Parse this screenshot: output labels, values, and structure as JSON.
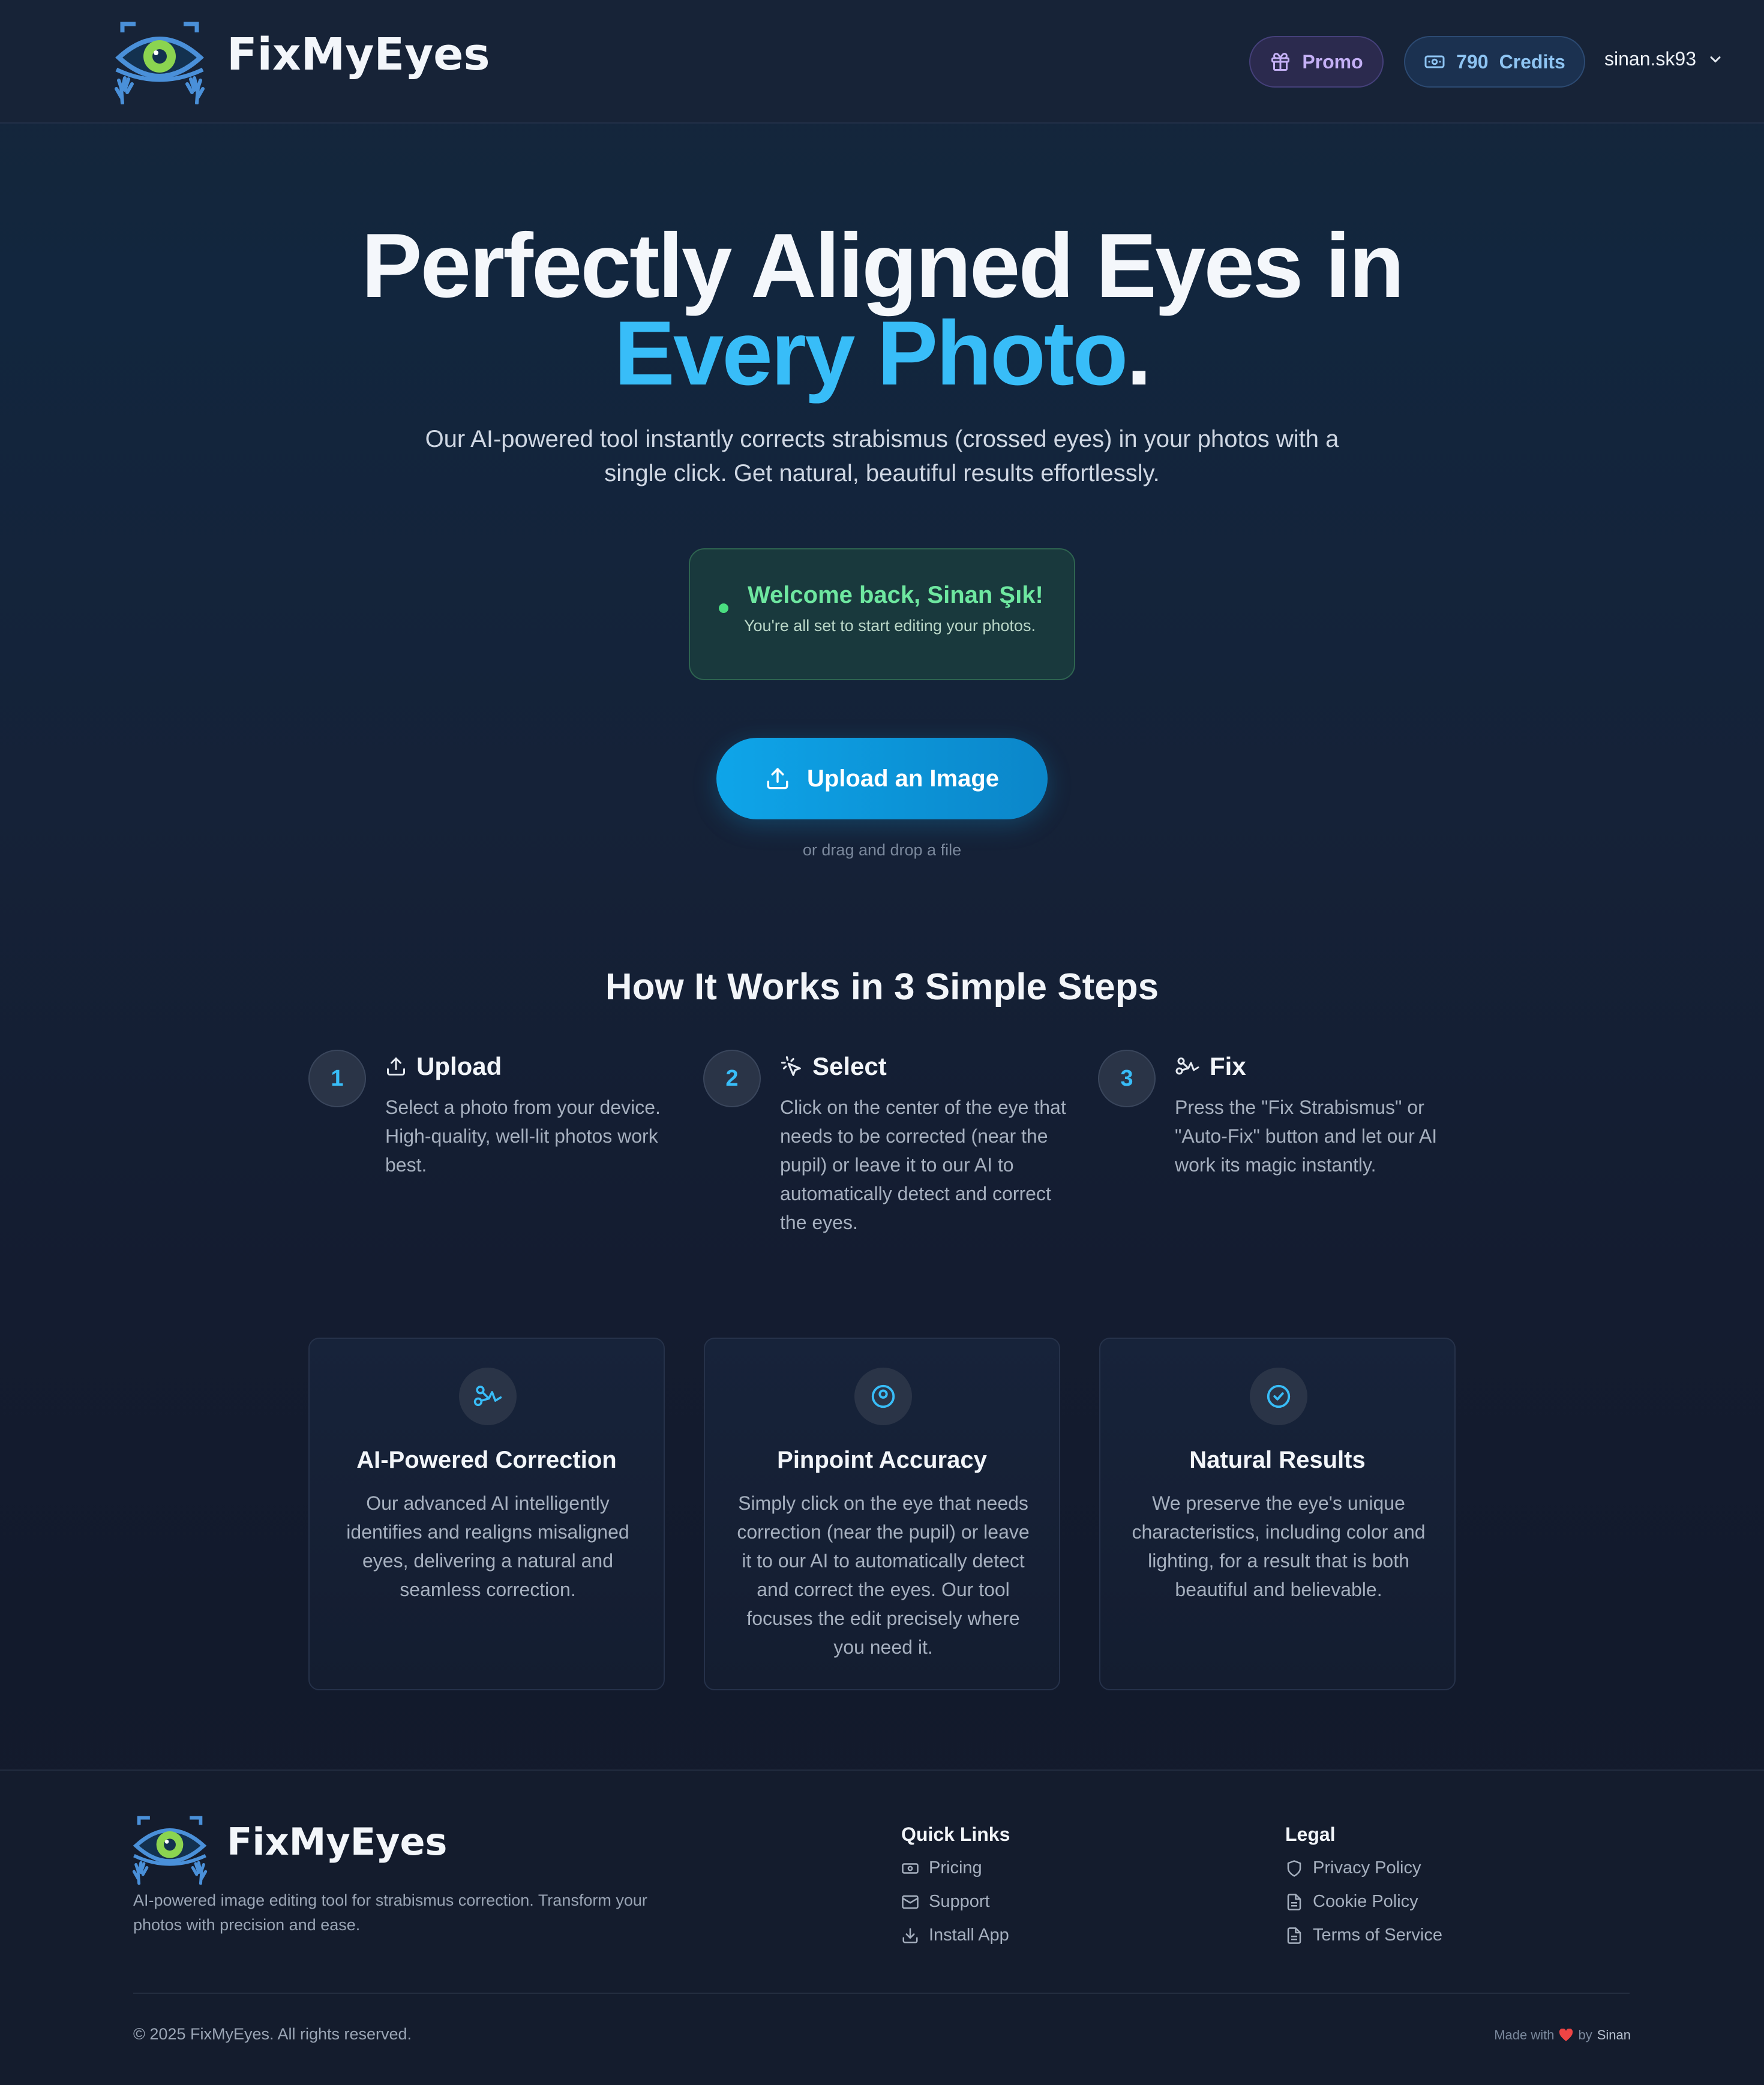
{
  "header": {
    "brand": "FixMyEyes",
    "promo_label": "Promo",
    "credits_count": "790",
    "credits_label": "Credits",
    "username": "sinan.sk93"
  },
  "hero": {
    "title_line1": "Perfectly Aligned Eyes in",
    "title_highlight": "Every Photo",
    "title_period": ".",
    "lead": "Our AI-powered tool instantly corrects strabismus (crossed eyes) in your photos with a single click. Get natural, beautiful results effortlessly.",
    "welcome_title": "Welcome back, Sinan Şık!",
    "welcome_sub": "You're all set to start editing your photos.",
    "upload_label": "Upload an Image",
    "drag_hint": "or drag and drop a file"
  },
  "steps": {
    "title": "How It Works in 3 Simple Steps",
    "items": [
      {
        "num": "1",
        "title": "Upload",
        "desc": "Select a photo from your device. High-quality, well-lit photos work best.",
        "icon": "upload-icon"
      },
      {
        "num": "2",
        "title": "Select",
        "desc": "Click on the center of the eye that needs to be corrected (near the pupil) or leave it to our AI to automatically detect and correct the eyes.",
        "icon": "pointer-click-icon"
      },
      {
        "num": "3",
        "title": "Fix",
        "desc": "Press the \"Fix Strabismus\" or \"Auto-Fix\" button and let our AI work its magic instantly.",
        "icon": "magic-icon"
      }
    ]
  },
  "features": [
    {
      "title": "AI-Powered Correction",
      "desc": "Our advanced AI intelligently identifies and realigns misaligned eyes, delivering a natural and seamless correction.",
      "icon": "magic-icon"
    },
    {
      "title": "Pinpoint Accuracy",
      "desc": "Simply click on the eye that needs correction (near the pupil) or leave it to our AI to automatically detect and correct the eyes. Our tool focuses the edit precisely where you need it.",
      "icon": "target-icon"
    },
    {
      "title": "Natural Results",
      "desc": "We preserve the eye's unique characteristics, including color and lighting, for a result that is both beautiful and believable.",
      "icon": "check-circle-icon"
    }
  ],
  "footer": {
    "brand": "FixMyEyes",
    "desc": "AI-powered image editing tool for strabismus correction. Transform your photos with precision and ease.",
    "quick_links_title": "Quick Links",
    "quick_links": [
      "Pricing",
      "Support",
      "Install App"
    ],
    "legal_title": "Legal",
    "legal_links": [
      "Privacy Policy",
      "Cookie Policy",
      "Terms of Service"
    ],
    "copyright": "© 2025 FixMyEyes. All rights reserved.",
    "made_with": "Made with",
    "made_by": "by",
    "author": "Sinan"
  },
  "colors": {
    "accent": "#38bdf8",
    "welcome_green": "#6ee7a0",
    "promo_text": "#c4b0f5",
    "credits_text": "#8ec4f2"
  }
}
